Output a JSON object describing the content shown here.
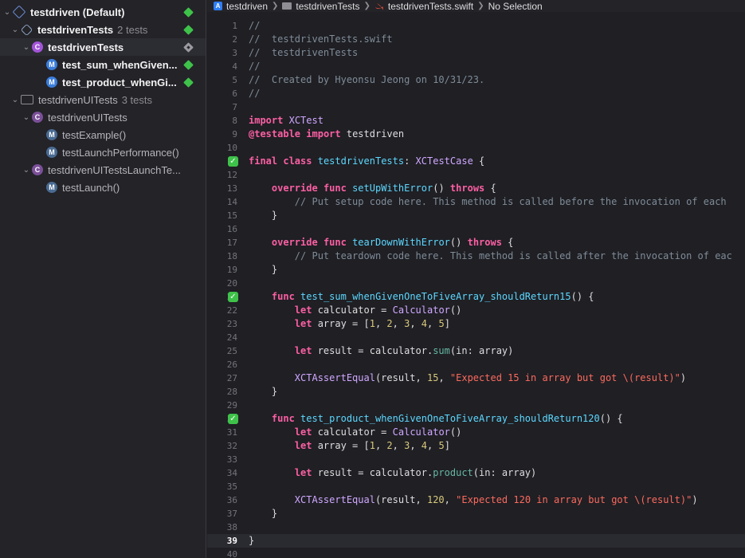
{
  "navigator": {
    "rows": [
      {
        "label": "testdriven (Default)",
        "count": "",
        "status": "pass"
      },
      {
        "label": "testdrivenTests",
        "count": "2 tests",
        "status": "pass"
      },
      {
        "label": "testdrivenTests",
        "count": "",
        "status": "partial"
      },
      {
        "label": "test_sum_whenGiven...",
        "count": "",
        "status": "pass"
      },
      {
        "label": "test_product_whenGi...",
        "count": "",
        "status": "pass"
      },
      {
        "label": "testdrivenUITests",
        "count": "3 tests",
        "status": "none"
      },
      {
        "label": "testdrivenUITests",
        "count": "",
        "status": "none"
      },
      {
        "label": "testExample()",
        "count": "",
        "status": "none"
      },
      {
        "label": "testLaunchPerformance()",
        "count": "",
        "status": "none"
      },
      {
        "label": "testdrivenUITestsLaunchTe...",
        "count": "",
        "status": "none"
      },
      {
        "label": "testLaunch()",
        "count": "",
        "status": "none"
      }
    ]
  },
  "jumpbar": {
    "project": "testdriven",
    "group": "testdrivenTests",
    "file": "testdrivenTests.swift",
    "selection": "No Selection"
  },
  "editor": {
    "current_line": 39,
    "lines": [
      {
        "n": "1",
        "text": "//"
      },
      {
        "n": "2",
        "text": "//  testdrivenTests.swift"
      },
      {
        "n": "3",
        "text": "//  testdrivenTests"
      },
      {
        "n": "4",
        "text": "//"
      },
      {
        "n": "5",
        "text": "//  Created by Hyeonsu Jeong on 10/31/23."
      },
      {
        "n": "6",
        "text": "//"
      },
      {
        "n": "7",
        "text": ""
      },
      {
        "n": "8",
        "text": "import XCTest"
      },
      {
        "n": "9",
        "text": "@testable import testdriven"
      },
      {
        "n": "10",
        "text": ""
      },
      {
        "n": "11",
        "text": "final class testdrivenTests: XCTestCase {"
      },
      {
        "n": "12",
        "text": ""
      },
      {
        "n": "13",
        "text": "    override func setUpWithError() throws {"
      },
      {
        "n": "14",
        "text": "        // Put setup code here. This method is called before the invocation of each"
      },
      {
        "n": "15",
        "text": "    }"
      },
      {
        "n": "16",
        "text": ""
      },
      {
        "n": "17",
        "text": "    override func tearDownWithError() throws {"
      },
      {
        "n": "18",
        "text": "        // Put teardown code here. This method is called after the invocation of eac"
      },
      {
        "n": "19",
        "text": "    }"
      },
      {
        "n": "20",
        "text": ""
      },
      {
        "n": "21",
        "text": "    func test_sum_whenGivenOneToFiveArray_shouldReturn15() {"
      },
      {
        "n": "22",
        "text": "        let calculator = Calculator()"
      },
      {
        "n": "23",
        "text": "        let array = [1, 2, 3, 4, 5]"
      },
      {
        "n": "24",
        "text": ""
      },
      {
        "n": "25",
        "text": "        let result = calculator.sum(in: array)"
      },
      {
        "n": "26",
        "text": ""
      },
      {
        "n": "27",
        "text": "        XCTAssertEqual(result, 15, \"Expected 15 in array but got \\(result)\")"
      },
      {
        "n": "28",
        "text": "    }"
      },
      {
        "n": "29",
        "text": ""
      },
      {
        "n": "30",
        "text": "    func test_product_whenGivenOneToFiveArray_shouldReturn120() {"
      },
      {
        "n": "31",
        "text": "        let calculator = Calculator()"
      },
      {
        "n": "32",
        "text": "        let array = [1, 2, 3, 4, 5]"
      },
      {
        "n": "33",
        "text": ""
      },
      {
        "n": "34",
        "text": "        let result = calculator.product(in: array)"
      },
      {
        "n": "35",
        "text": ""
      },
      {
        "n": "36",
        "text": "        XCTAssertEqual(result, 120, \"Expected 120 in array but got \\(result)\")"
      },
      {
        "n": "37",
        "text": "    }"
      },
      {
        "n": "38",
        "text": ""
      },
      {
        "n": "39",
        "text": "}"
      },
      {
        "n": "40",
        "text": ""
      }
    ],
    "test_markers": [
      "11",
      "21",
      "30"
    ]
  },
  "colors": {
    "pass": "#3fc24a",
    "keyword": "#fc5fa3",
    "comment": "#7f8c98",
    "type": "#d0a8ff",
    "declaration": "#5dd8ff",
    "function": "#67b7a4",
    "number": "#d9c97c",
    "string": "#fc6a5d"
  }
}
